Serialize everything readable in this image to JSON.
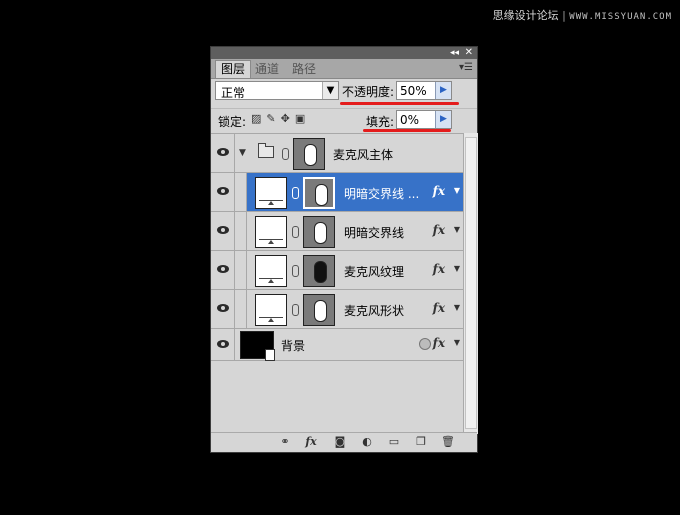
{
  "watermark": {
    "text": "思缘设计论坛",
    "sep": "|",
    "site": "WWW.MISSYUAN.COM"
  },
  "panel": {
    "tabs": [
      "图层",
      "通道",
      "路径"
    ],
    "blend_mode": "正常",
    "opacity_label": "不透明度:",
    "opacity_value": "50%",
    "lock_label": "锁定:",
    "fill_label": "填充:",
    "fill_value": "0%",
    "accent_color": "#3772c8",
    "annotation_color": "#e41c1c"
  },
  "layers": [
    {
      "name": "麦克风主体",
      "type": "group",
      "expanded": true
    },
    {
      "name": "明暗交界线 ...",
      "fx": "fx",
      "selected": true
    },
    {
      "name": "明暗交界线",
      "fx": "fx"
    },
    {
      "name": "麦克风纹理",
      "fx": "fx",
      "dark_mask": true
    },
    {
      "name": "麦克风形状",
      "fx": "fx"
    },
    {
      "name": "背景",
      "fx": "fx",
      "type": "background"
    }
  ],
  "bottom_icons": [
    "link-icon",
    "fx-icon",
    "mask-icon",
    "adjustment-icon",
    "folder-icon",
    "new-layer-icon",
    "trash-icon"
  ]
}
